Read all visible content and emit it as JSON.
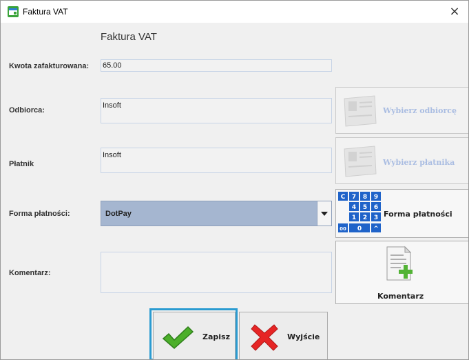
{
  "window": {
    "title": "Faktura VAT",
    "close_glyph": "×"
  },
  "form": {
    "heading": "Faktura VAT",
    "amount": {
      "label": "Kwota zafakturowana:",
      "value": "65.00"
    },
    "recipient": {
      "label": "Odbiorca:",
      "value": "Insoft",
      "button_label": "Wybierz odbiorcę"
    },
    "payer": {
      "label": "Płatnik",
      "value": "Insoft",
      "button_label": "Wybierz płatnika"
    },
    "payment": {
      "label": "Forma płatności:",
      "selected": "DotPay",
      "button_label": "Forma płatności",
      "keypad_keys": [
        "C",
        "7",
        "8",
        "9",
        "4",
        "5",
        "6",
        "1",
        "2",
        "3",
        "00",
        "0",
        "^"
      ]
    },
    "comment": {
      "label": "Komentarz:",
      "value": "",
      "button_label": "Komentarz"
    }
  },
  "actions": {
    "save_label": "Zapisz",
    "exit_label": "Wyjście"
  },
  "colors": {
    "accent_focus": "#2a9bd1",
    "select_bg": "#a5b6d0",
    "save_check": "#4caf2a",
    "exit_x": "#e62525"
  },
  "icons": {
    "app": "app-window-icon",
    "close": "close-icon",
    "recipient": "address-card-icon",
    "payer": "address-card-icon",
    "payment": "keypad-icon",
    "comment": "document-add-icon",
    "save": "checkmark-icon",
    "exit": "cross-icon"
  }
}
